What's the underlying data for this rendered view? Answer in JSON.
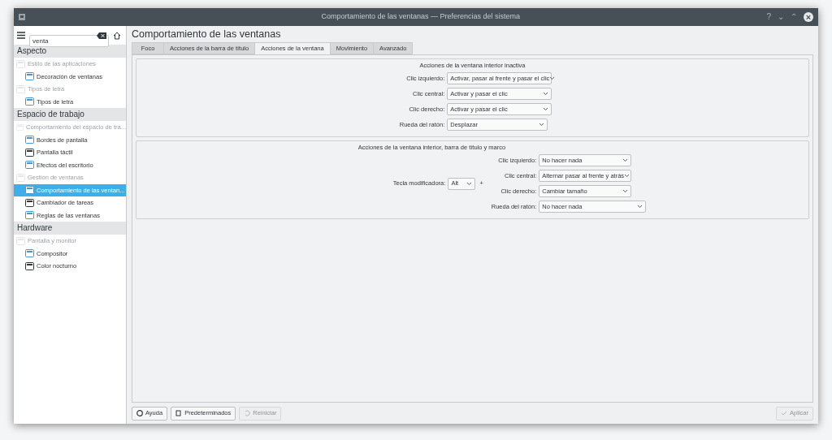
{
  "window": {
    "title": "Comportamiento de las ventanas — Preferencias del sistema",
    "controls": [
      "?",
      "⌄",
      "⌃",
      "×"
    ]
  },
  "sidebar": {
    "search": {
      "value": "venta"
    },
    "sections": [
      {
        "title": "Aspecto",
        "items": [
          {
            "label": "Estilo de las aplicaciones",
            "kind": "group",
            "disabled": true,
            "selected": false
          },
          {
            "label": "Decoración de ventanas",
            "kind": "module",
            "disabled": false,
            "selected": false
          },
          {
            "label": "Tipos de letra",
            "kind": "group",
            "disabled": true,
            "selected": false
          },
          {
            "label": "Tipos de letra",
            "kind": "module",
            "disabled": false,
            "selected": false
          }
        ]
      },
      {
        "title": "Espacio de trabajo",
        "items": [
          {
            "label": "Comportamiento del espacio de tra...",
            "kind": "group",
            "disabled": true,
            "selected": false
          },
          {
            "label": "Bordes de pantalla",
            "kind": "module",
            "disabled": false,
            "selected": false
          },
          {
            "label": "Pantalla táctil",
            "kind": "module",
            "disabled": false,
            "selected": false
          },
          {
            "label": "Efectos del escritorio",
            "kind": "module",
            "disabled": false,
            "selected": false
          },
          {
            "label": "Gestión de ventanas",
            "kind": "group",
            "disabled": true,
            "selected": false
          },
          {
            "label": "Comportamiento de las ventan...",
            "kind": "module",
            "disabled": false,
            "selected": true
          },
          {
            "label": "Cambiador de tareas",
            "kind": "module",
            "disabled": false,
            "selected": false
          },
          {
            "label": "Reglas de las ventanas",
            "kind": "module",
            "disabled": false,
            "selected": false
          }
        ]
      },
      {
        "title": "Hardware",
        "items": [
          {
            "label": "Pantalla y monitor",
            "kind": "group",
            "disabled": true,
            "selected": false
          },
          {
            "label": "Compositor",
            "kind": "module",
            "disabled": false,
            "selected": false
          },
          {
            "label": "Color nocturno",
            "kind": "module",
            "disabled": false,
            "selected": false
          }
        ]
      }
    ]
  },
  "page_title": "Comportamiento de las ventanas",
  "tabs": [
    {
      "label": "Foco",
      "selected": false
    },
    {
      "label": "Acciones de la barra de título",
      "selected": false
    },
    {
      "label": "Acciones de la ventana",
      "selected": true
    },
    {
      "label": "Movimiento",
      "selected": false
    },
    {
      "label": "Avanzado",
      "selected": false
    }
  ],
  "inactive_group": {
    "title": "Acciones de la ventana interior inactiva",
    "rows": [
      {
        "label": "Clic izquierdo:",
        "value": "Activar, pasar al frente y pasar el clic"
      },
      {
        "label": "Clic central:",
        "value": "Activar y pasar el clic"
      },
      {
        "label": "Clic derecho:",
        "value": "Activar y pasar el clic"
      },
      {
        "label": "Rueda del ratón:",
        "value": "Desplazar"
      }
    ]
  },
  "frame_group": {
    "title": "Acciones de la ventana interior, barra de título y marco",
    "modifier_label": "Tecla modificadora:",
    "modifier_value": "Alt",
    "plus": "+",
    "rows": [
      {
        "label": "Clic izquierdo:",
        "value": "No hacer nada"
      },
      {
        "label": "Clic central:",
        "value": "Alternar pasar al frente y atrás"
      },
      {
        "label": "Clic derecho:",
        "value": "Cambiar tamaño"
      },
      {
        "label": "Rueda del ratón:",
        "value": "No hacer nada"
      }
    ]
  },
  "buttons": [
    {
      "label": "Ayuda",
      "disabled": false
    },
    {
      "label": "Predeterminados",
      "disabled": false
    },
    {
      "label": "Reiniciar",
      "disabled": true
    },
    {
      "label": "Aplicar",
      "disabled": true
    }
  ]
}
